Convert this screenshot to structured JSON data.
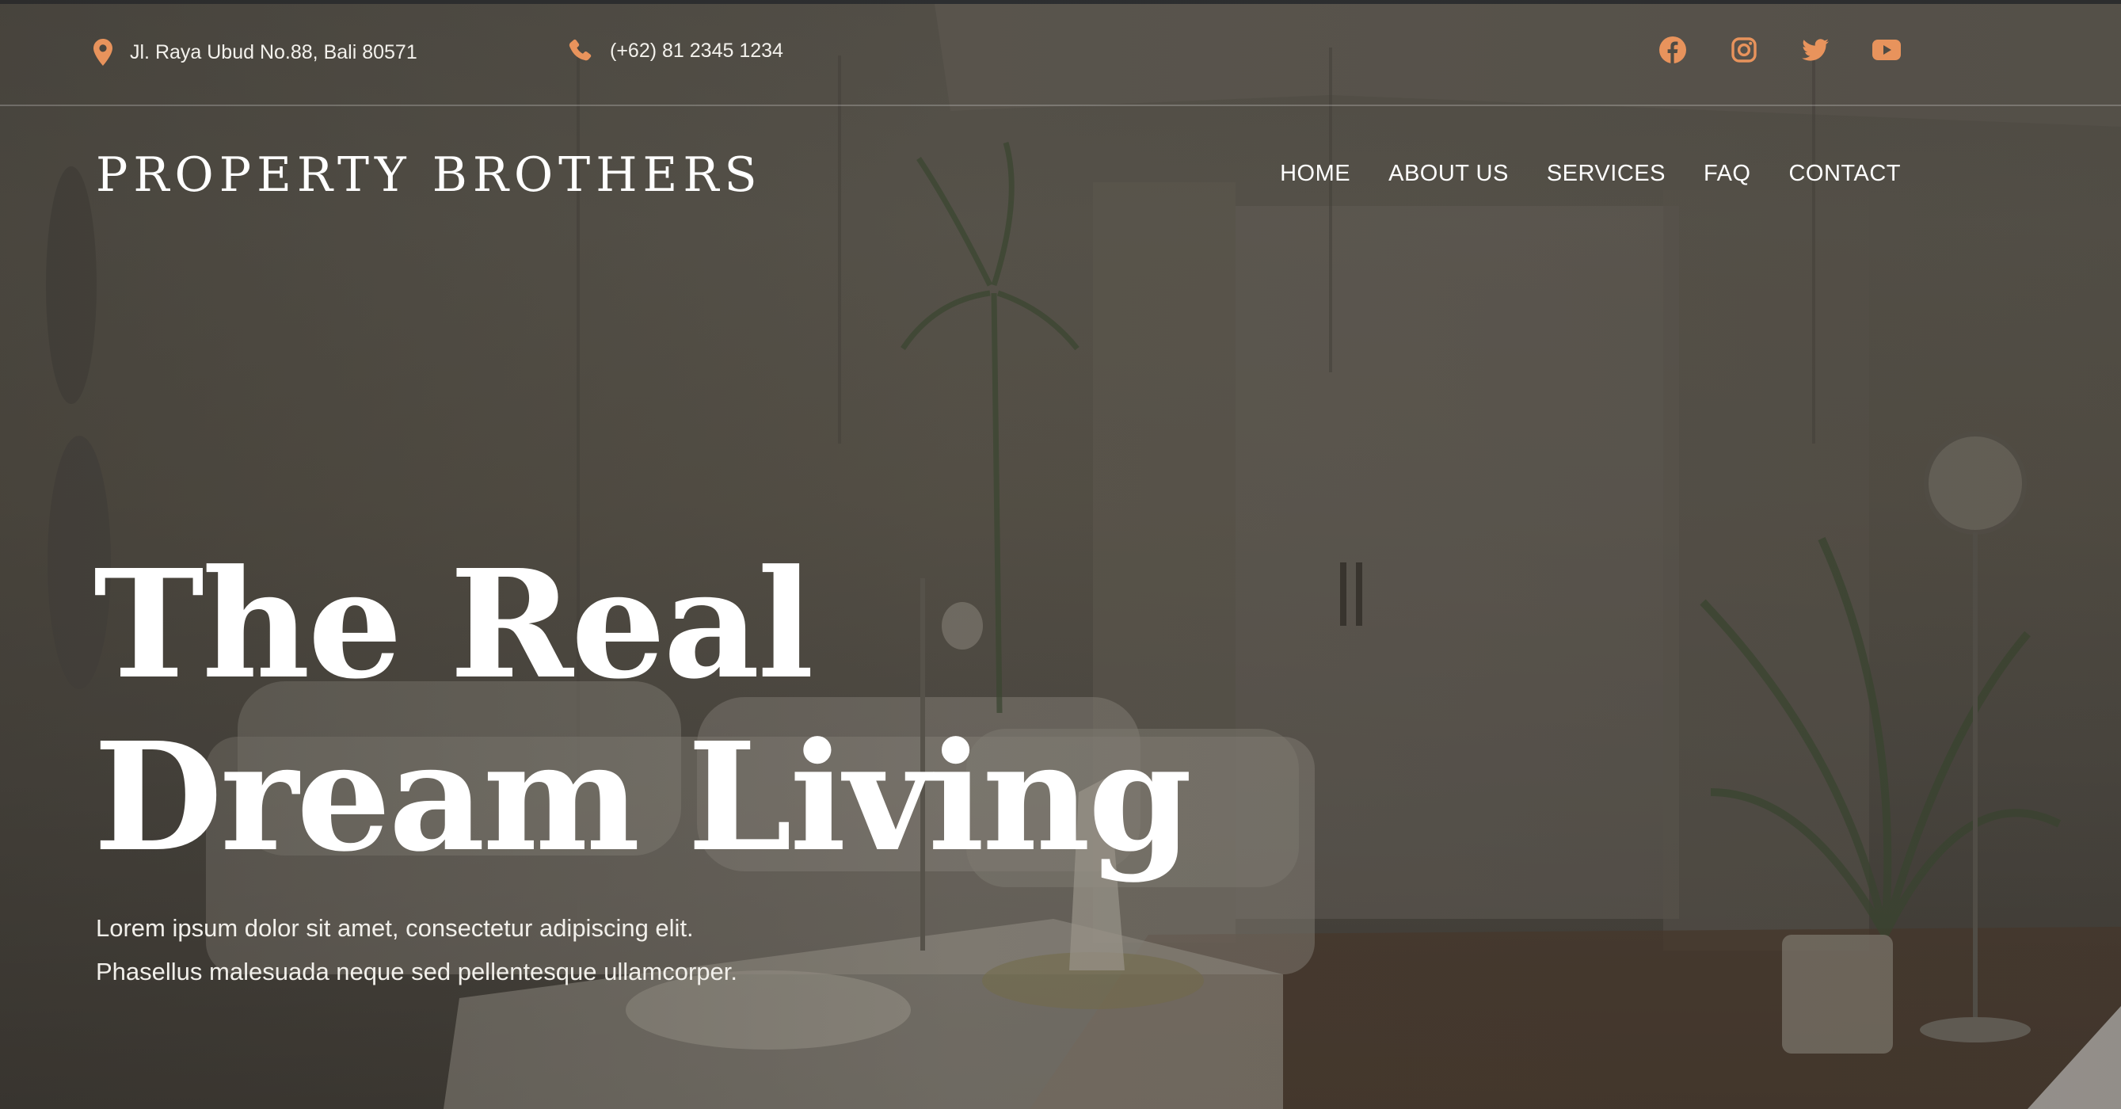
{
  "topbar": {
    "address": "Jl. Raya Ubud No.88, Bali 80571",
    "phone": "(+62) 81 2345 1234",
    "socials": [
      {
        "icon": "facebook-icon"
      },
      {
        "icon": "instagram-icon"
      },
      {
        "icon": "twitter-icon"
      },
      {
        "icon": "youtube-icon"
      }
    ],
    "accent_color": "#e8935c"
  },
  "brand": "PROPERTY BROTHERS",
  "nav": {
    "items": [
      "HOME",
      "ABOUT US",
      "SERVICES",
      "FAQ",
      "CONTACT"
    ]
  },
  "hero": {
    "headline_line1": "The Real",
    "headline_line2": "Dream Living",
    "lead_line1": "Lorem ipsum dolor sit amet, consectetur adipiscing elit.",
    "lead_line2": "Phasellus malesuada neque sed pellentesque ullamcorper."
  }
}
